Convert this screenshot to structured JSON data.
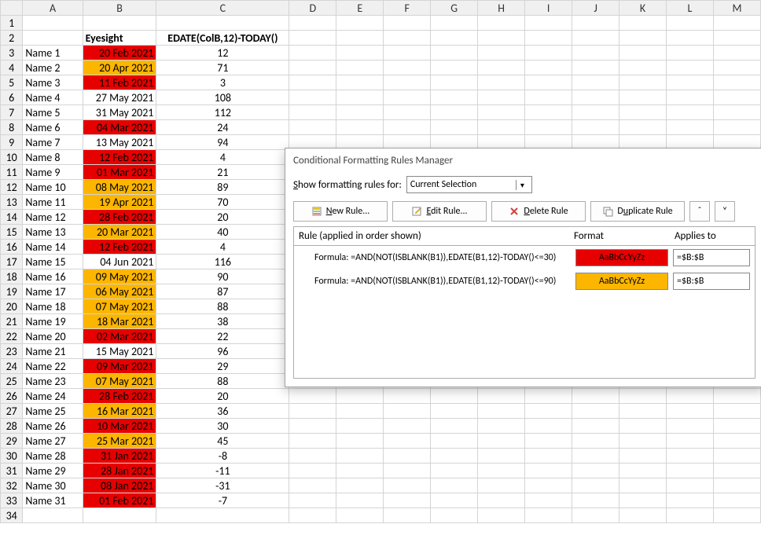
{
  "columns": [
    "A",
    "B",
    "C",
    "D",
    "E",
    "F",
    "G",
    "H",
    "I",
    "J",
    "K",
    "L",
    "M"
  ],
  "header": {
    "B": "Eyesight",
    "C": "EDATE(ColB,12)-TODAY()"
  },
  "rows": [
    {
      "n": 1,
      "A": "",
      "B": "",
      "C": ""
    },
    {
      "n": 2,
      "A": "",
      "B": "Eyesight",
      "C": "EDATE(ColB,12)-TODAY()"
    },
    {
      "n": 3,
      "A": "Name 1",
      "B": "20 Feb 2021",
      "C": "12",
      "bg": "red"
    },
    {
      "n": 4,
      "A": "Name 2",
      "B": "20 Apr 2021",
      "C": "71",
      "bg": "amber"
    },
    {
      "n": 5,
      "A": "Name 3",
      "B": "11 Feb 2021",
      "C": "3",
      "bg": "red"
    },
    {
      "n": 6,
      "A": "Name 4",
      "B": "27 May 2021",
      "C": "108",
      "bg": ""
    },
    {
      "n": 7,
      "A": "Name 5",
      "B": "31 May 2021",
      "C": "112",
      "bg": ""
    },
    {
      "n": 8,
      "A": "Name 6",
      "B": "04 Mar 2021",
      "C": "24",
      "bg": "red"
    },
    {
      "n": 9,
      "A": "Name 7",
      "B": "13 May 2021",
      "C": "94",
      "bg": ""
    },
    {
      "n": 10,
      "A": "Name 8",
      "B": "12 Feb 2021",
      "C": "4",
      "bg": "red"
    },
    {
      "n": 11,
      "A": "Name 9",
      "B": "01 Mar 2021",
      "C": "21",
      "bg": "red"
    },
    {
      "n": 12,
      "A": "Name 10",
      "B": "08 May 2021",
      "C": "89",
      "bg": "amber"
    },
    {
      "n": 13,
      "A": "Name 11",
      "B": "19 Apr 2021",
      "C": "70",
      "bg": "amber"
    },
    {
      "n": 14,
      "A": "Name 12",
      "B": "28 Feb 2021",
      "C": "20",
      "bg": "red"
    },
    {
      "n": 15,
      "A": "Name 13",
      "B": "20 Mar 2021",
      "C": "40",
      "bg": "amber"
    },
    {
      "n": 16,
      "A": "Name 14",
      "B": "12 Feb 2021",
      "C": "4",
      "bg": "red"
    },
    {
      "n": 17,
      "A": "Name 15",
      "B": "04 Jun 2021",
      "C": "116",
      "bg": ""
    },
    {
      "n": 18,
      "A": "Name 16",
      "B": "09 May 2021",
      "C": "90",
      "bg": "amber"
    },
    {
      "n": 19,
      "A": "Name 17",
      "B": "06 May 2021",
      "C": "87",
      "bg": "amber"
    },
    {
      "n": 20,
      "A": "Name 18",
      "B": "07 May 2021",
      "C": "88",
      "bg": "amber"
    },
    {
      "n": 21,
      "A": "Name 19",
      "B": "18 Mar 2021",
      "C": "38",
      "bg": "amber"
    },
    {
      "n": 22,
      "A": "Name 20",
      "B": "02 Mar 2021",
      "C": "22",
      "bg": "red"
    },
    {
      "n": 23,
      "A": "Name 21",
      "B": "15 May 2021",
      "C": "96",
      "bg": ""
    },
    {
      "n": 24,
      "A": "Name 22",
      "B": "09 Mar 2021",
      "C": "29",
      "bg": "red"
    },
    {
      "n": 25,
      "A": "Name 23",
      "B": "07 May 2021",
      "C": "88",
      "bg": "amber"
    },
    {
      "n": 26,
      "A": "Name 24",
      "B": "28 Feb 2021",
      "C": "20",
      "bg": "red"
    },
    {
      "n": 27,
      "A": "Name 25",
      "B": "16 Mar 2021",
      "C": "36",
      "bg": "amber"
    },
    {
      "n": 28,
      "A": "Name 26",
      "B": "10 Mar 2021",
      "C": "30",
      "bg": "red"
    },
    {
      "n": 29,
      "A": "Name 27",
      "B": "25 Mar 2021",
      "C": "45",
      "bg": "amber"
    },
    {
      "n": 30,
      "A": "Name 28",
      "B": "31 Jan 2021",
      "C": "-8",
      "bg": "red"
    },
    {
      "n": 31,
      "A": "Name 29",
      "B": "28 Jan 2021",
      "C": "-11",
      "bg": "red"
    },
    {
      "n": 32,
      "A": "Name 30",
      "B": "08 Jan 2021",
      "C": "-31",
      "bg": "red"
    },
    {
      "n": 33,
      "A": "Name 31",
      "B": "01 Feb 2021",
      "C": "-7",
      "bg": "red"
    },
    {
      "n": 34,
      "A": "",
      "B": "",
      "C": "",
      "bg": ""
    }
  ],
  "dialog": {
    "title": "Conditional Formatting Rules Manager",
    "show_label_pre": "S",
    "show_label_post": "how formatting rules for:",
    "show_value": "Current Selection",
    "buttons": {
      "new": "New Rule...",
      "edit": "Edit Rule...",
      "delete": "Delete Rule",
      "duplicate": "Duplicate Rule"
    },
    "head": {
      "rule": "Rule (applied in order shown)",
      "format": "Format",
      "applies": "Applies to"
    },
    "rules": [
      {
        "formula": "Formula: =AND(NOT(ISBLANK(B1)),EDATE(B1,12)-TODAY()<=30)",
        "sample": "AaBbCcYyZz",
        "applies": "=$B:$B",
        "color": "red"
      },
      {
        "formula": "Formula: =AND(NOT(ISBLANK(B1)),EDATE(B1,12)-TODAY()<=90)",
        "sample": "AaBbCcYyZz",
        "applies": "=$B:$B",
        "color": "amber"
      }
    ]
  }
}
